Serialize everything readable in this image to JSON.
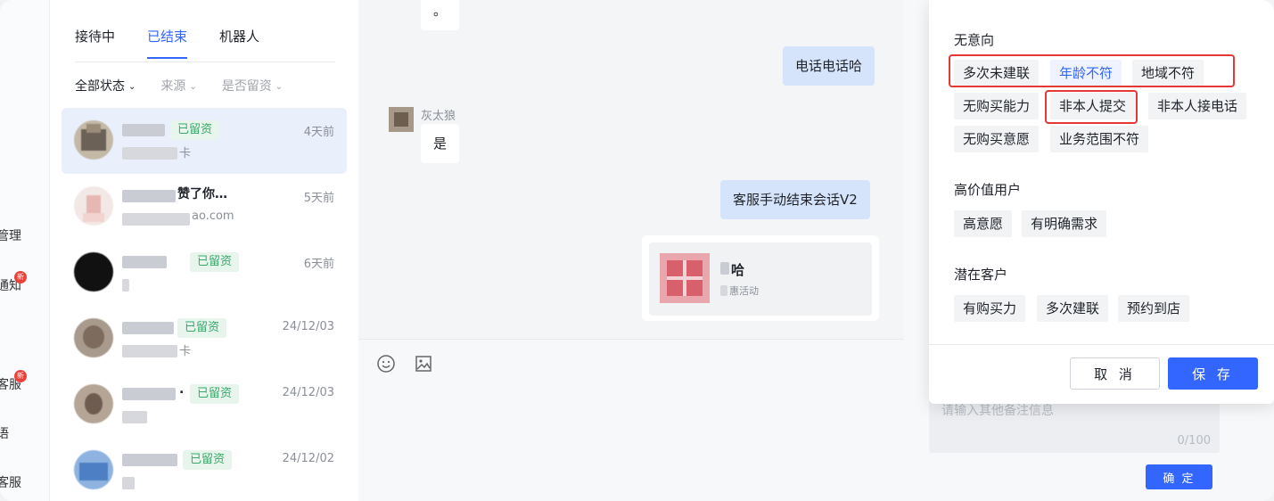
{
  "leftnav": {
    "items": [
      {
        "label": "管理",
        "badge": ""
      },
      {
        "label": "通知",
        "badge": "新"
      },
      {
        "label": "客服",
        "badge": "新"
      },
      {
        "label": "语",
        "badge": ""
      },
      {
        "label": "客服",
        "badge": ""
      }
    ]
  },
  "session": {
    "tabs": [
      "接待中",
      "已结束",
      "机器人"
    ],
    "active_tab": "已结束",
    "filters": [
      "全部状态",
      "来源",
      "是否留资"
    ],
    "rows": [
      {
        "name": "",
        "tag": "已留资",
        "sub": "卡",
        "time": "4天前",
        "selected": true
      },
      {
        "name": "赞了你…",
        "tag": "",
        "sub": "ao.com",
        "time": "5天前",
        "selected": false
      },
      {
        "name": "",
        "tag": "已留资",
        "sub": "",
        "time": "6天前",
        "selected": false
      },
      {
        "name": "",
        "tag": "已留资",
        "sub": "卡",
        "time": "24/12/03",
        "selected": false
      },
      {
        "name": ".",
        "tag": "已留资",
        "sub": "",
        "time": "24/12/03",
        "selected": false
      },
      {
        "name": "",
        "tag": "已留资",
        "sub": "",
        "time": "24/12/02",
        "selected": false
      }
    ]
  },
  "chat": {
    "messages": [
      {
        "direction": "in",
        "text": "。"
      },
      {
        "direction": "out",
        "text": "电话电话哈"
      },
      {
        "direction": "in",
        "sender": "灰太狼",
        "text": "是"
      },
      {
        "direction": "out",
        "text": "客服手动结束会话V2"
      }
    ],
    "card": {
      "title": "哈",
      "subtitle": "惠活动"
    },
    "input_icons": [
      "emoji-icon",
      "image-icon"
    ]
  },
  "remark": {
    "placeholder": "请输入其他备注信息",
    "count": "0/100",
    "confirm_label": "确 定"
  },
  "popup": {
    "sections": [
      {
        "title": "无意向",
        "tags": [
          "多次未建联",
          "年龄不符",
          "地域不符",
          "无购买能力",
          "非本人提交",
          "非本人接电话",
          "无购买意愿",
          "业务范围不符"
        ]
      },
      {
        "title": "高价值用户",
        "tags": [
          "高意愿",
          "有明确需求"
        ]
      },
      {
        "title": "潜在客户",
        "tags": [
          "有购买力",
          "多次建联",
          "预约到店"
        ]
      }
    ],
    "selected_tag": "年龄不符",
    "cancel_label": "取 消",
    "save_label": "保 存"
  },
  "colors": {
    "accent": "#3366ff",
    "tag_green": "#3aa86b",
    "highlight_red": "#e53935"
  }
}
